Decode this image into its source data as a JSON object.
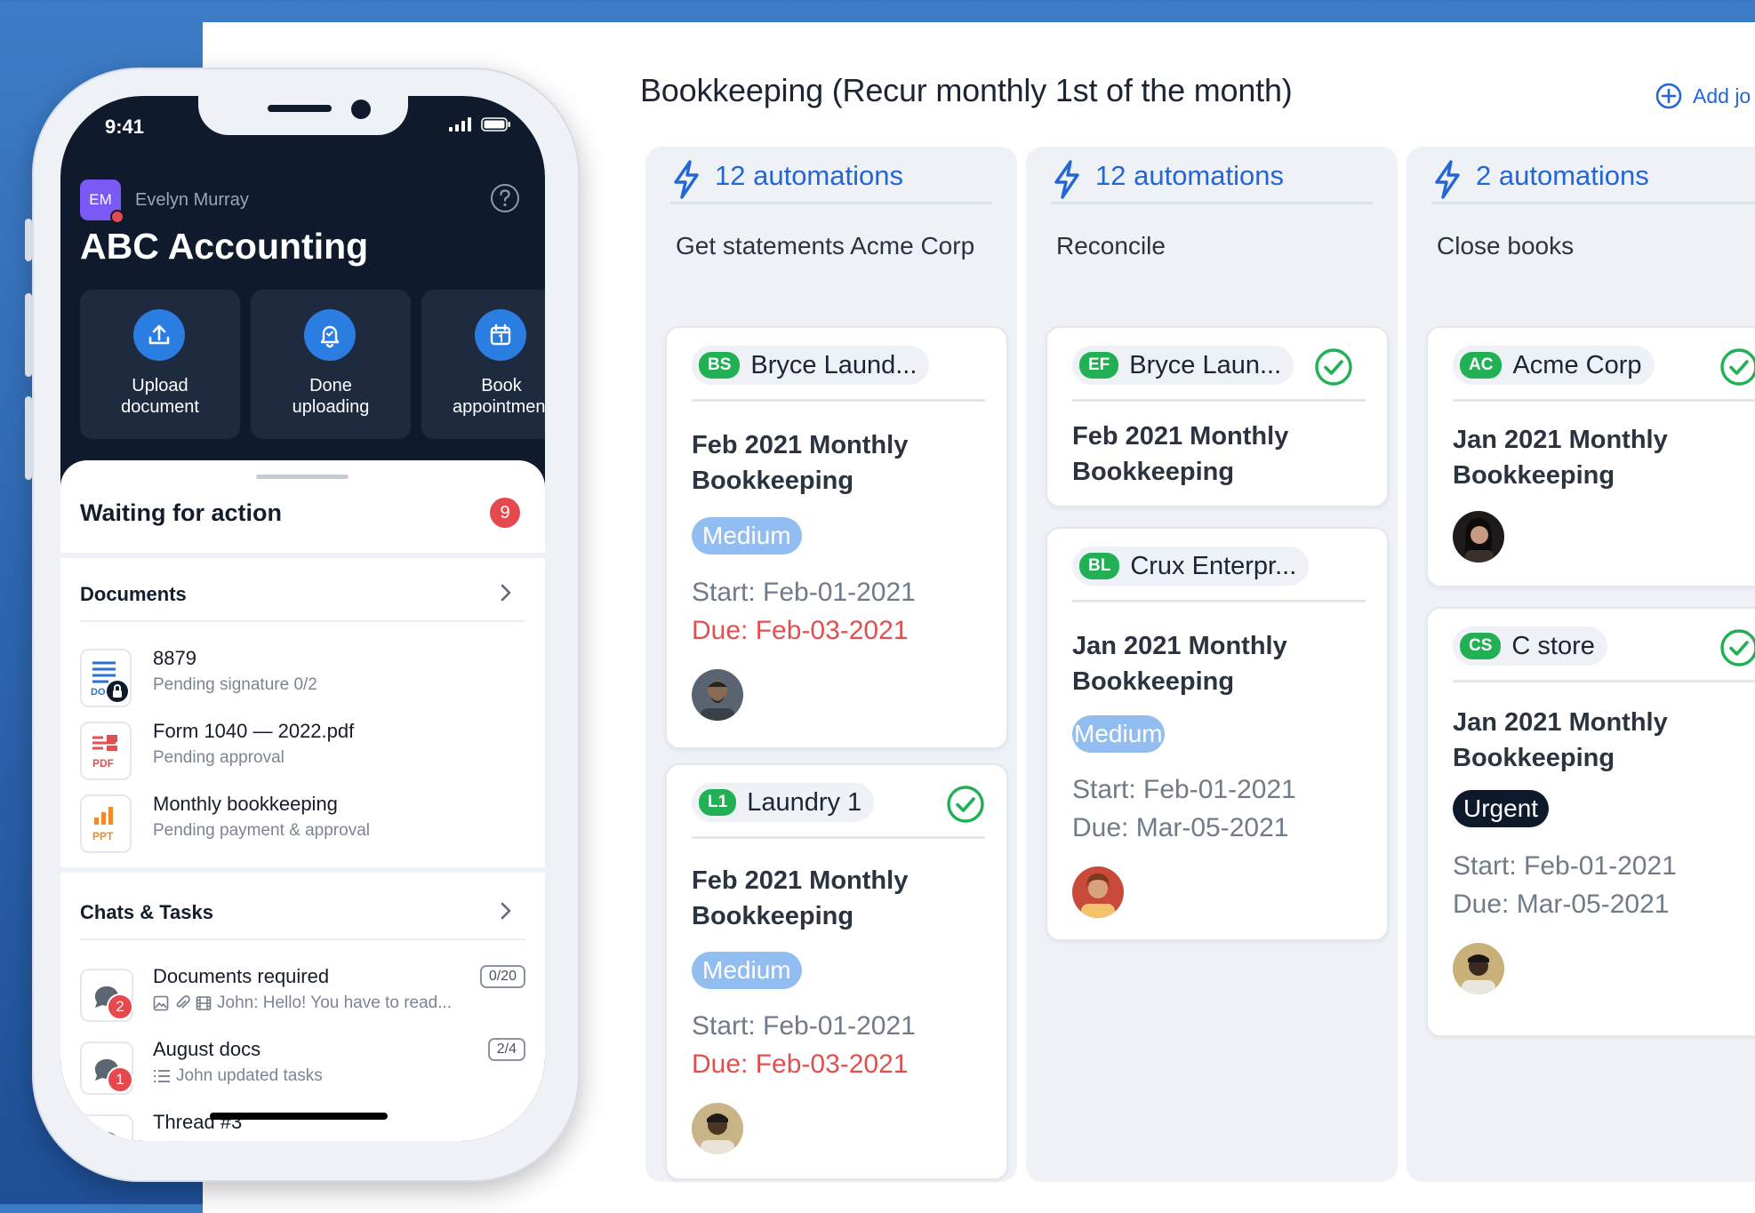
{
  "board": {
    "title": "Bookkeeping (Recur monthly 1st of the month)",
    "add_label": "Add jo",
    "columns": [
      {
        "automations": "12 automations",
        "title": "Get statements Acme Corp",
        "cards": [
          {
            "initials": "BS",
            "client": "Bryce Laund...",
            "title_l1": "Feb 2021 Monthly",
            "title_l2": "Bookkeeping",
            "priority": "Medium",
            "start": "Start: Feb-01-2021",
            "due": "Due: Feb-03-2021",
            "done": false
          },
          {
            "initials": "L1",
            "client": "Laundry 1",
            "title_l1": "Feb 2021 Monthly",
            "title_l2": "Bookkeeping",
            "priority": "Medium",
            "start": "Start: Feb-01-2021",
            "due": "Due: Feb-03-2021",
            "done": true
          }
        ]
      },
      {
        "automations": "12 automations",
        "title": "Reconcile",
        "cards": [
          {
            "initials": "EF",
            "client": "Bryce Laun...",
            "title_l1": "Feb 2021 Monthly",
            "title_l2": "Bookkeeping",
            "done": true
          },
          {
            "initials": "BL",
            "client": "Crux Enterpr...",
            "title_l1": "Jan 2021 Monthly",
            "title_l2": "Bookkeeping",
            "priority": "Medium",
            "start": "Start: Feb-01-2021",
            "due": "Due: Mar-05-2021",
            "done": false
          }
        ]
      },
      {
        "automations": "2 automations",
        "title": "Close books",
        "cards": [
          {
            "initials": "AC",
            "client": "Acme Corp",
            "title_l1": "Jan 2021 Monthly",
            "title_l2": "Bookkeeping",
            "done": true
          },
          {
            "initials": "CS",
            "client": "C store",
            "title_l1": "Jan 2021 Monthly",
            "title_l2": "Bookkeeping",
            "priority": "Urgent",
            "start": "Start: Feb-01-2021",
            "due": "Due: Mar-05-2021",
            "done": true
          }
        ]
      }
    ]
  },
  "phone": {
    "time": "9:41",
    "user_initials": "EM",
    "user_name": "Evelyn Murray",
    "company": "ABC Accounting",
    "actions": [
      {
        "label": "Upload\ndocument",
        "icon": "upload-icon"
      },
      {
        "label": "Done\nuploading",
        "icon": "bell-icon"
      },
      {
        "label": "Book\nappointment",
        "icon": "calendar-icon"
      }
    ],
    "waiting_title": "Waiting for action",
    "waiting_count": "9",
    "documents_title": "Documents",
    "documents": [
      {
        "title": "8879",
        "subtitle": "Pending signature 0/2",
        "type": "DOC"
      },
      {
        "title": "Form 1040 — 2022.pdf",
        "subtitle": "Pending approval",
        "type": "PDF"
      },
      {
        "title": "Monthly bookkeeping",
        "subtitle": "Pending payment & approval",
        "type": "PPT"
      }
    ],
    "chats_title": "Chats & Tasks",
    "chats": [
      {
        "title": "Documents required",
        "subtitle": "John: Hello! You have to read...",
        "badge": "2",
        "count": "0/20"
      },
      {
        "title": "August docs",
        "subtitle": "John updated tasks",
        "badge": "1",
        "count": "2/4"
      },
      {
        "title": "Thread #3"
      }
    ]
  },
  "colors": {
    "accent": "#2467d4",
    "success": "#22b055",
    "danger": "#e05050",
    "dark": "#0f1a2c"
  }
}
